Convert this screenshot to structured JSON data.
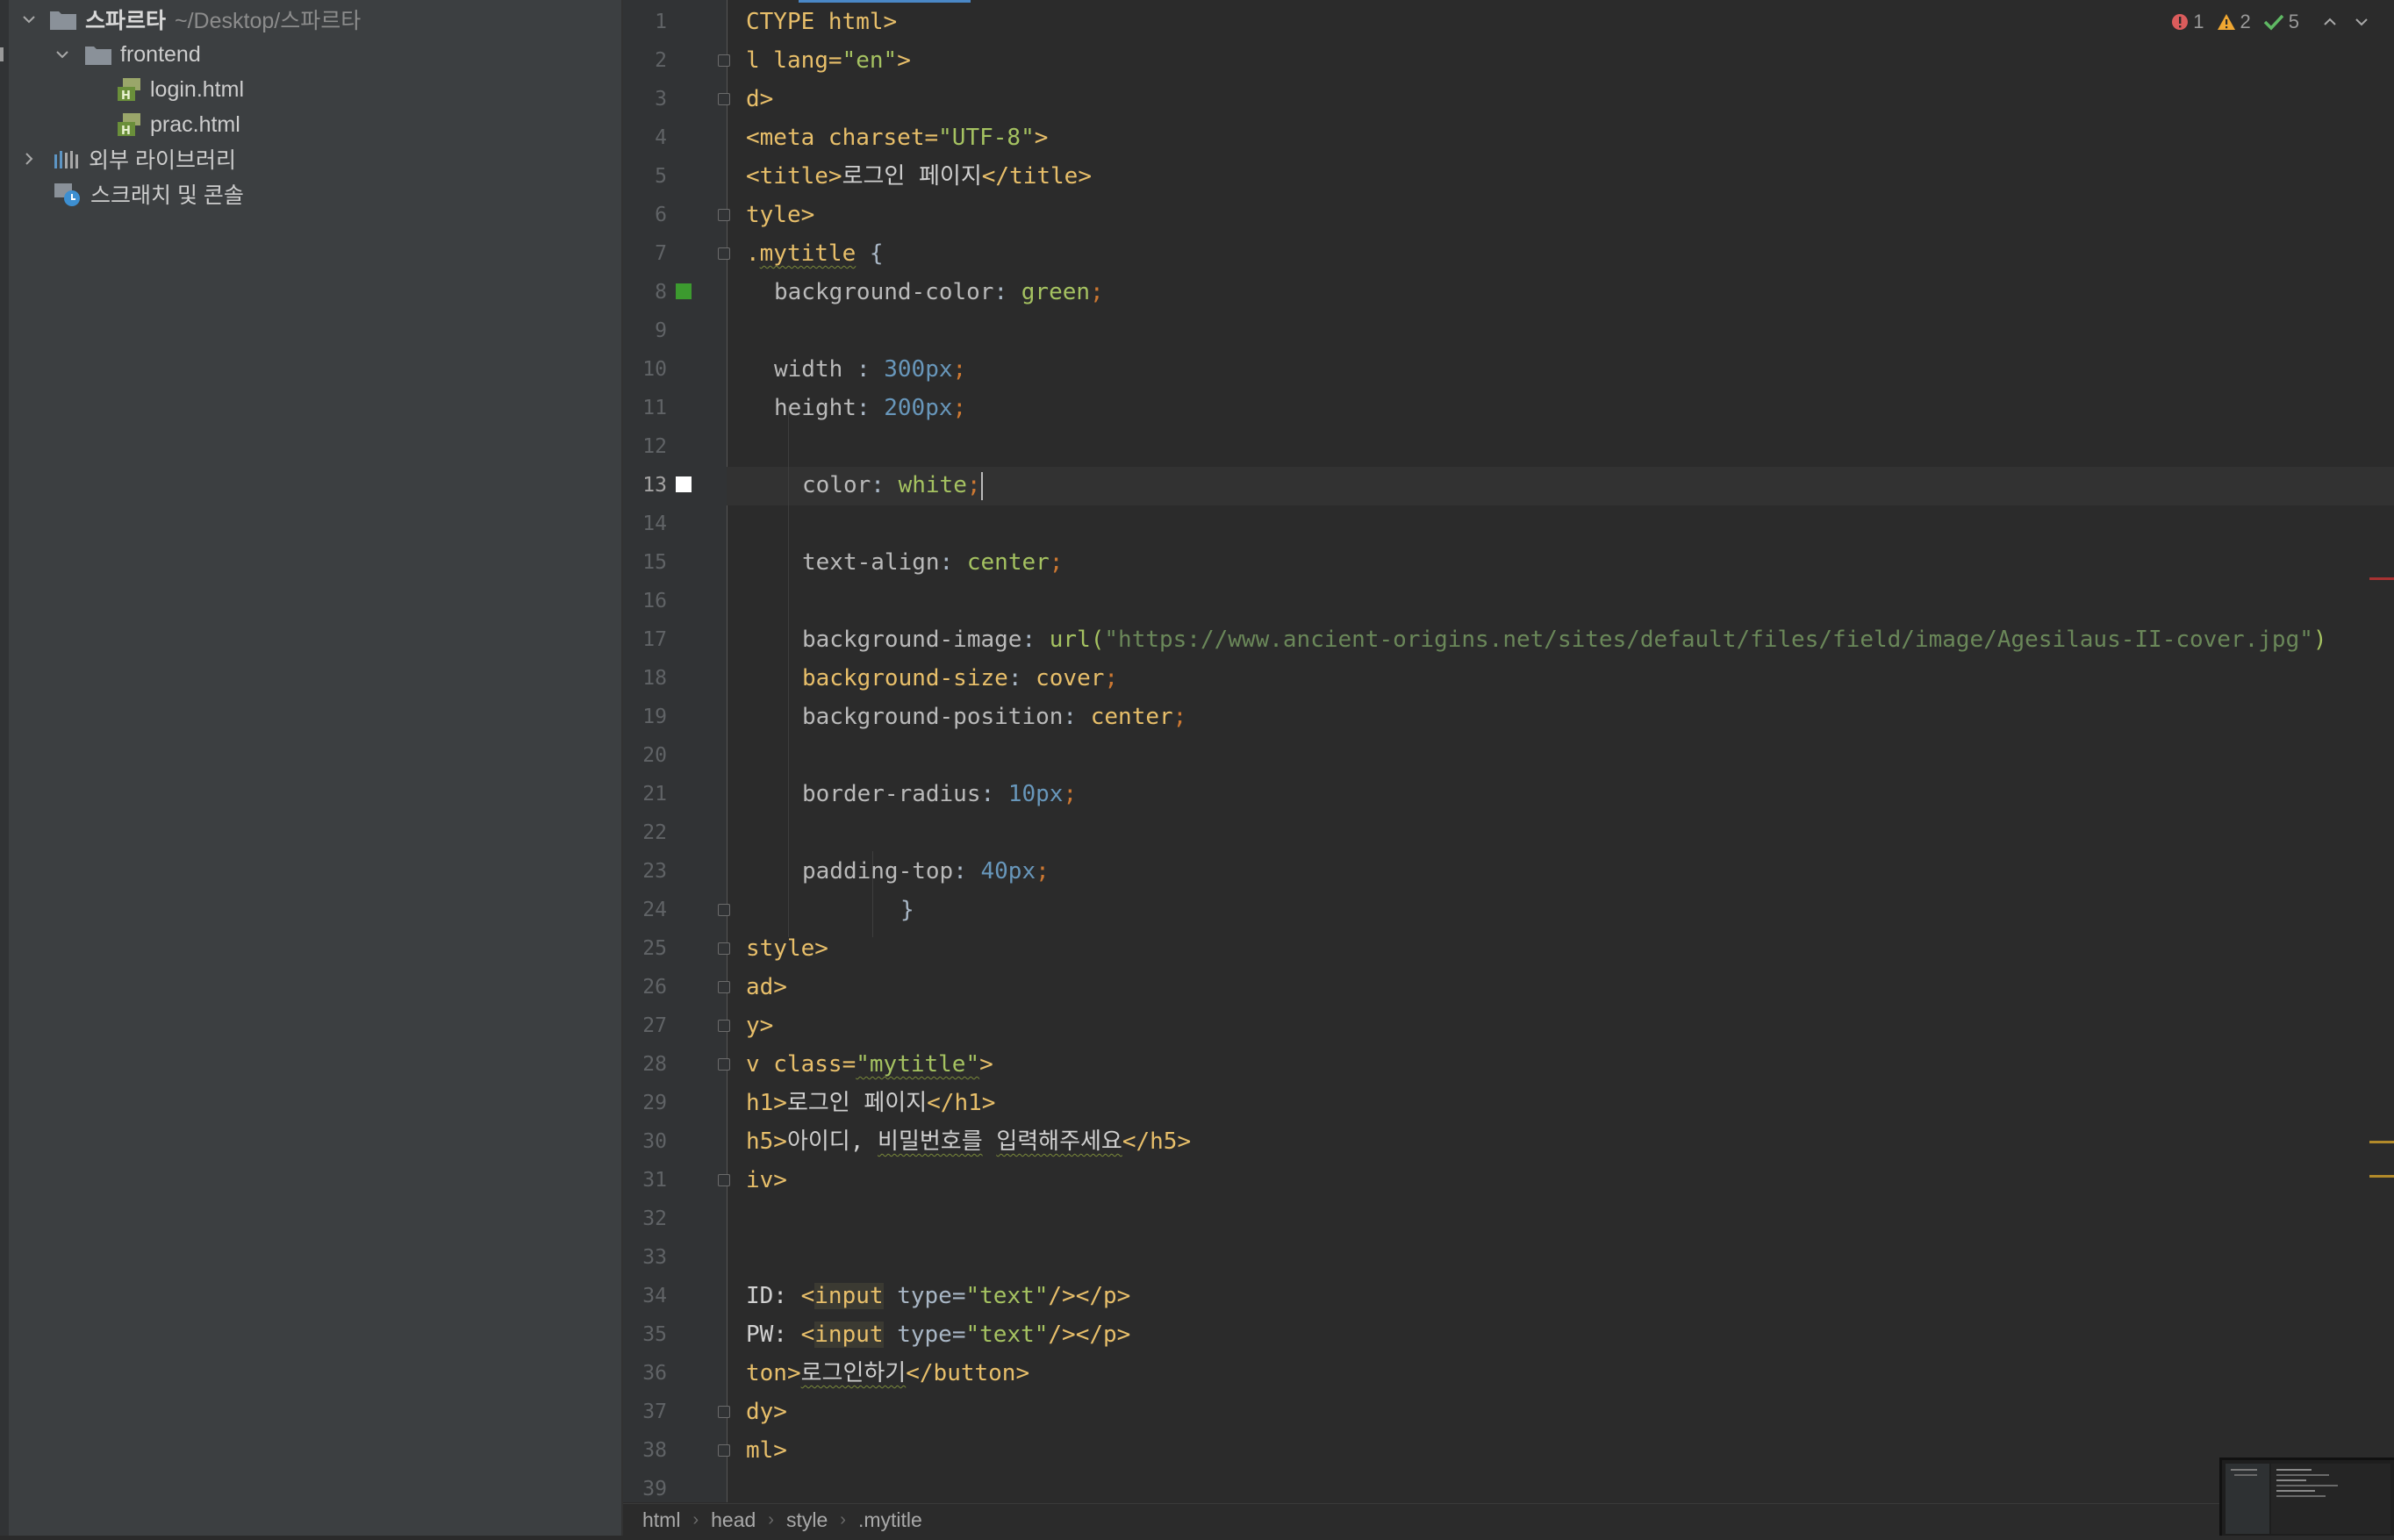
{
  "project_tree": {
    "root": {
      "label": "스파르타",
      "path": "~/Desktop/스파르타"
    },
    "folder": {
      "label": "frontend"
    },
    "files": [
      {
        "label": "login.html"
      },
      {
        "label": "prac.html"
      }
    ],
    "external_libraries": {
      "label": "외부 라이브러리"
    },
    "scratches": {
      "label": "스크래치 및 콘솔"
    }
  },
  "editor": {
    "current_line": 13,
    "line_numbers": [
      "1",
      "2",
      "3",
      "4",
      "5",
      "6",
      "7",
      "8",
      "9",
      "10",
      "11",
      "12",
      "13",
      "14",
      "15",
      "16",
      "17",
      "18",
      "19",
      "20",
      "21",
      "22",
      "23",
      "24",
      "25",
      "26",
      "27",
      "28",
      "29",
      "30",
      "31",
      "32",
      "33",
      "34",
      "35",
      "36",
      "37",
      "38",
      "39"
    ],
    "code": {
      "l1": {
        "a": "CTYPE html>"
      },
      "l2": {
        "a": "l lang=",
        "b": "\"en\"",
        "c": ">"
      },
      "l3": {
        "a": "d>"
      },
      "l4": {
        "a": "<meta charset=",
        "b": "\"UTF-8\"",
        "c": ">"
      },
      "l5": {
        "a": "<title>",
        "b": "로그인 페이지",
        "c": "</title>"
      },
      "l6": {
        "a": "tyle>"
      },
      "l7": {
        "a": ".",
        "b": "mytitle",
        "c": " {"
      },
      "l8": {
        "a": "background-color",
        "b": ": ",
        "c": "green",
        "d": ";"
      },
      "l10": {
        "a": "width",
        "b": " : ",
        "c": "300px",
        "d": ";"
      },
      "l11": {
        "a": "height",
        "b": ": ",
        "c": "200px",
        "d": ";"
      },
      "l13": {
        "a": "color",
        "b": ": ",
        "c": "white",
        "d": ";"
      },
      "l15": {
        "a": "text-align",
        "b": ": ",
        "c": "center",
        "d": ";"
      },
      "l17": {
        "a": "background-image",
        "b": ": ",
        "c": "url(",
        "d": "\"https://www.ancient-origins.net/sites/default/files/field/image/Agesilaus-II-cover.jpg\"",
        "e": ")"
      },
      "l18": {
        "a": "background-size",
        "b": ": ",
        "c": "cover",
        "d": ";"
      },
      "l19": {
        "a": "background-position",
        "b": ": ",
        "c": "center",
        "d": ";"
      },
      "l21": {
        "a": "border-radius",
        "b": ": ",
        "c": "10px",
        "d": ";"
      },
      "l23": {
        "a": "padding-top",
        "b": ": ",
        "c": "40px",
        "d": ";"
      },
      "l24": {
        "a": "}"
      },
      "l25": {
        "a": "style>"
      },
      "l26": {
        "a": "ad>"
      },
      "l27": {
        "a": "y>"
      },
      "l28": {
        "a": "v class=",
        "b": "\"mytitle\"",
        "c": ">"
      },
      "l29": {
        "a": "h1>",
        "b": "로그인 페이지",
        "c": "</h1>"
      },
      "l30": {
        "a": "h5>",
        "b": "아이디, ",
        "c": "비밀번호를",
        "d": " ",
        "e": "입력해주세요",
        "f": "</h5>"
      },
      "l31": {
        "a": "iv>"
      },
      "l34": {
        "a": "ID: ",
        "b": "<",
        "c": "input",
        "d": " type=",
        "e": "\"text\"",
        "f": "/></p>"
      },
      "l35": {
        "a": "PW: ",
        "b": "<",
        "c": "input",
        "d": " type=",
        "e": "\"text\"",
        "f": "/></p>"
      },
      "l36": {
        "a": "ton>",
        "b": "로그인하기",
        "c": "</button>"
      },
      "l37": {
        "a": "dy>"
      },
      "l38": {
        "a": "ml>"
      }
    }
  },
  "indicators": {
    "errors": "1",
    "warnings": "2",
    "ok": "5"
  },
  "colors": {
    "green_swatch": "#3c9a2f",
    "white_swatch": "#ffffff",
    "error": "#db5c5c",
    "warning": "#f0a732",
    "ok": "#5fb863"
  },
  "breadcrumbs": [
    "html",
    "head",
    "style",
    ".mytitle"
  ]
}
